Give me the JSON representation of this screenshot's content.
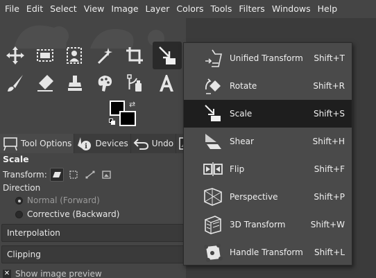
{
  "menubar": [
    "File",
    "Edit",
    "Select",
    "View",
    "Image",
    "Layer",
    "Colors",
    "Tools",
    "Filters",
    "Windows",
    "Help"
  ],
  "tabs": [
    {
      "label": "Tool Options",
      "icon": "tool-options-icon"
    },
    {
      "label": "Devices",
      "icon": "devices-icon"
    },
    {
      "label": "Undo",
      "icon": "undo-icon"
    }
  ],
  "tool_options": {
    "title": "Scale",
    "transform_label": "Transform:",
    "direction_label": "Direction",
    "direction_options": [
      "Normal (Forward)",
      "Corrective (Backward)"
    ],
    "interpolation_label": "Interpolation",
    "clipping_label": "Clipping",
    "show_preview_label": "Show image preview"
  },
  "transform_menu": [
    {
      "label": "Unified Transform",
      "shortcut": "Shift+T",
      "icon": "unified-transform-icon"
    },
    {
      "label": "Rotate",
      "shortcut": "Shift+R",
      "icon": "rotate-icon"
    },
    {
      "label": "Scale",
      "shortcut": "Shift+S",
      "icon": "scale-icon",
      "highlighted": true
    },
    {
      "label": "Shear",
      "shortcut": "Shift+H",
      "icon": "shear-icon"
    },
    {
      "label": "Flip",
      "shortcut": "Shift+F",
      "icon": "flip-icon"
    },
    {
      "label": "Perspective",
      "shortcut": "Shift+P",
      "icon": "perspective-icon"
    },
    {
      "label": "3D Transform",
      "shortcut": "Shift+W",
      "icon": "3d-transform-icon"
    },
    {
      "label": "Handle Transform",
      "shortcut": "Shift+L",
      "icon": "handle-transform-icon"
    }
  ],
  "colors": {
    "foreground": "#000000",
    "background": "#000000",
    "highlight": "#1e1e1e"
  }
}
